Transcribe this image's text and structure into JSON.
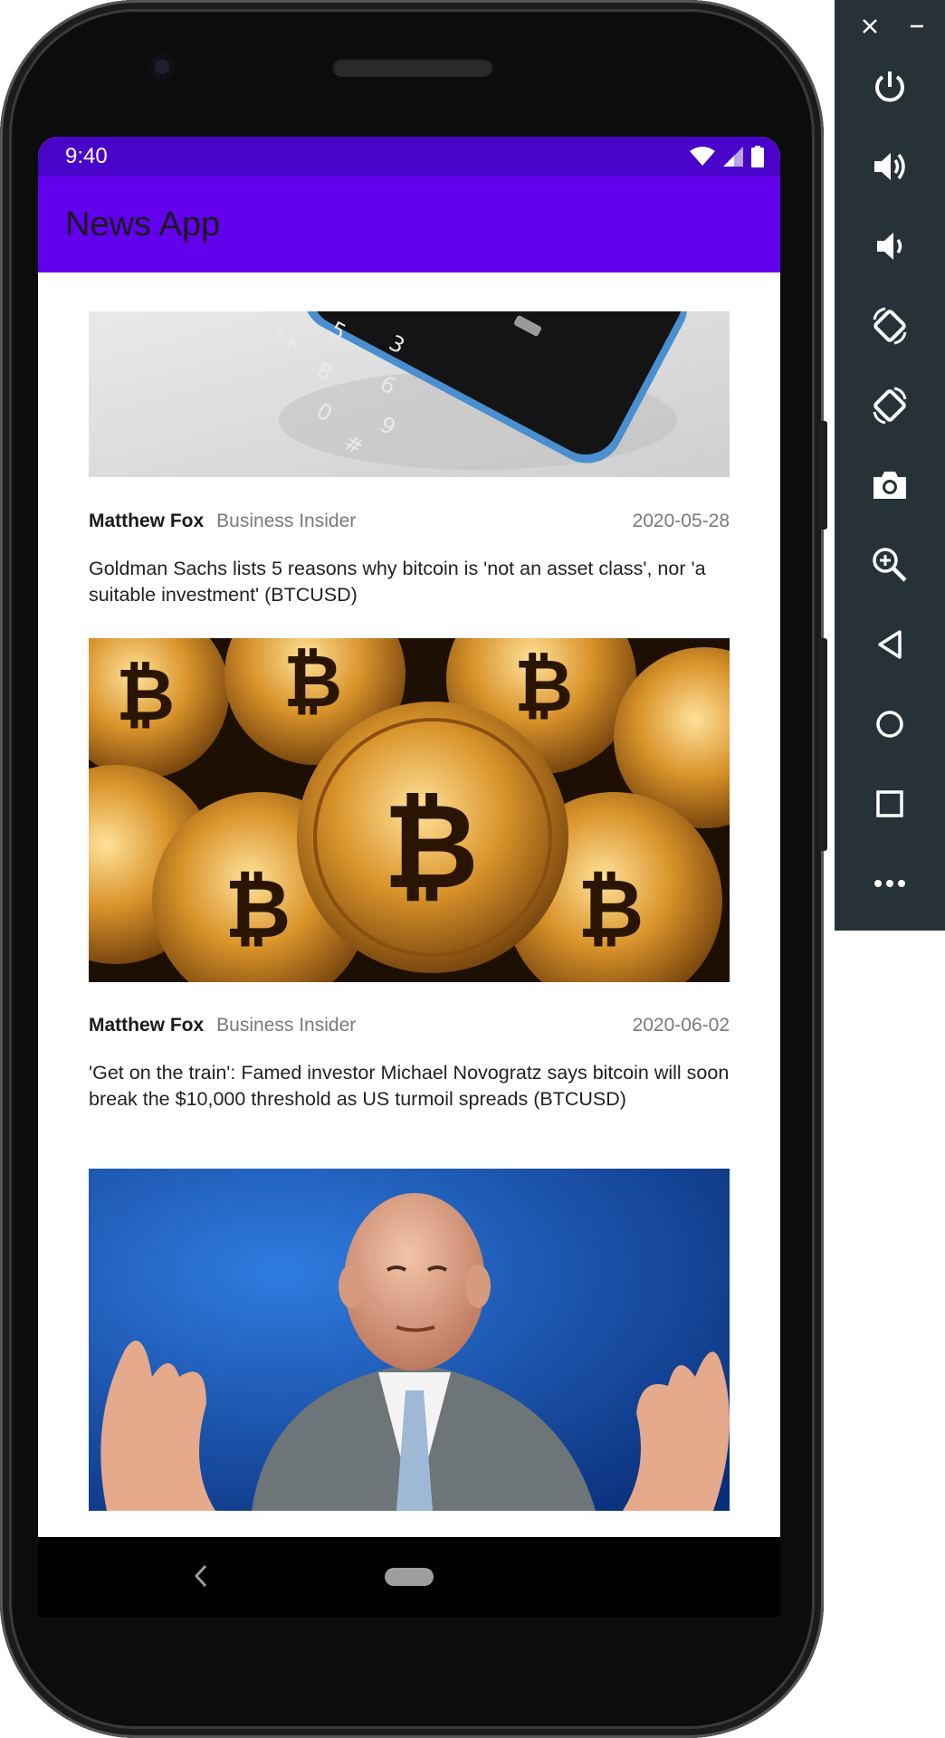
{
  "status_bar": {
    "time": "9:40"
  },
  "app_bar": {
    "title": "News App"
  },
  "articles": [
    {
      "author": "Matthew Fox",
      "source": "Business Insider",
      "date": "2020-05-28",
      "title": "Goldman Sachs lists 5 reasons why bitcoin is 'not an asset class', nor 'a suitable investment' (BTCUSD)",
      "image": "bitcoin-coins"
    },
    {
      "author": "Matthew Fox",
      "source": "Business Insider",
      "date": "2020-06-02",
      "title": "'Get on the train': Famed investor Michael Novogratz says bitcoin will soon break the $10,000 threshold as US turmoil spreads (BTCUSD)",
      "image": "investor-portrait"
    }
  ],
  "top_image": "feature-phone-keypad",
  "emulator_toolbar": {
    "buttons": [
      "close-icon",
      "minimize-icon",
      "power-icon",
      "volume-up-icon",
      "volume-down-icon",
      "rotate-left-icon",
      "rotate-right-icon",
      "camera-icon",
      "zoom-icon",
      "back-icon",
      "home-icon",
      "overview-icon",
      "more-icon"
    ]
  },
  "colors": {
    "status_bar": "#4a04c9",
    "app_bar": "#6200ee",
    "emulator_panel": "#263238"
  }
}
